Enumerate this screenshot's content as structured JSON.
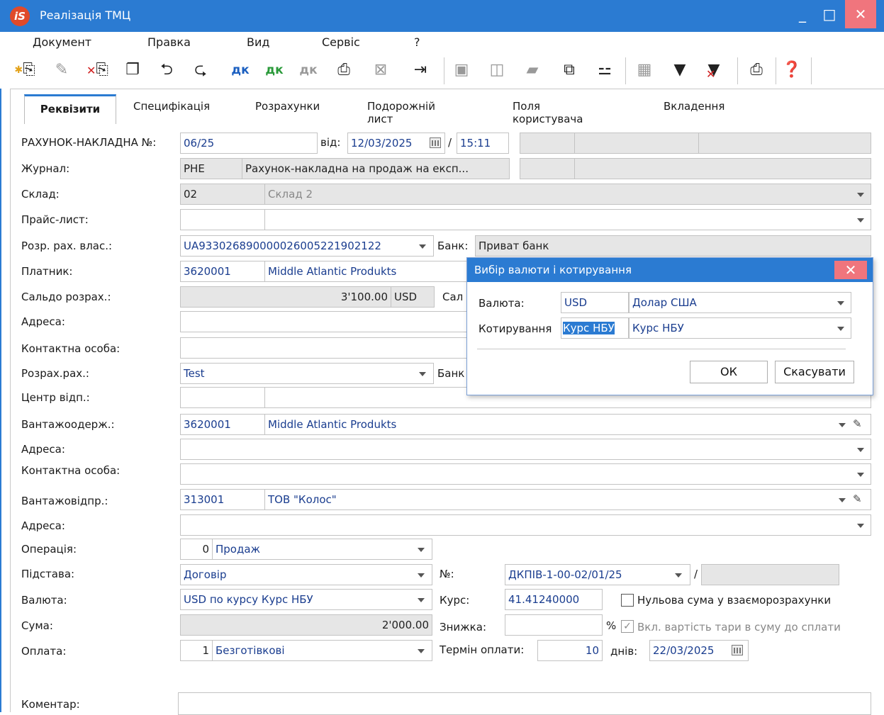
{
  "window": {
    "logo": "iS",
    "title": "Реалізація ТМЦ",
    "minimize": "_",
    "maximize": "□",
    "close": "✕"
  },
  "menu": [
    "Документ",
    "Правка",
    "Вид",
    "Сервіс",
    "?"
  ],
  "toolbar_icons": [
    "add-doc-icon",
    "edit-doc-icon",
    "delete-doc-icon",
    "copy-doc-icon",
    "return-doc-icon",
    "forward-doc-icon",
    "dk-icon",
    "dk-up-icon",
    "dk-down-icon",
    "print-preview-icon",
    "cancel-icon",
    "export-icon",
    "save-icon",
    "book-icon",
    "folder-icon",
    "link-icon",
    "hierarchy-icon",
    "grid-icon",
    "filter-icon",
    "clear-filter-icon",
    "print-icon",
    "help-icon"
  ],
  "tabs": [
    "Реквізити",
    "Специфікація",
    "Розрахунки",
    "Подорожній лист",
    "Поля користувача",
    "Вкладення"
  ],
  "form": {
    "invoice_label": "РАХУНОК-НАКЛАДНА №:",
    "invoice_no": "06/25",
    "from_label": "від:",
    "date": "12/03/2025",
    "time_sep": "/",
    "time": "15:11",
    "journal_label": "Журнал:",
    "journal_code": "РНЕ",
    "journal_name": "Рахунок-накладна на продаж на експ...",
    "warehouse_label": "Склад:",
    "warehouse_code": "02",
    "warehouse_name": "Склад 2",
    "pricelist_label": "Прайс-лист:",
    "account_label": "Розр. рах. влас.:",
    "account_value": "UA933026890000026005221902122",
    "bank_label": "Банк:",
    "bank_value": "Приват банк",
    "payer_label": "Платник:",
    "payer_code": "3620001",
    "payer_name": "Middle Atlantic Produkts",
    "balance_label": "Сальдо розрах.:",
    "balance_value": "3'100.00",
    "balance_currency": "USD",
    "balance_trailing": "Сал",
    "address_label": "Адреса:",
    "contact_label": "Контактна особа:",
    "settle_label": "Розрах.рах.:",
    "settle_value": "Test",
    "settle_bank_label": "Банк",
    "center_label": "Центр відп.:",
    "consignee_label": "Вантажоодерж.:",
    "consignee_code": "3620001",
    "consignee_name": "Middle Atlantic Produkts",
    "address2_label": "Адреса:",
    "contact2_label": "Контактна особа:",
    "shipper_label": "Вантажовідпр.:",
    "shipper_code": "313001",
    "shipper_name": "ТОВ \"Колос\"",
    "address3_label": "Адреса:",
    "operation_label": "Операція:",
    "operation_code": "0",
    "operation_name": "Продаж",
    "basis_label": "Підстава:",
    "basis_value": "Договір",
    "number_label": "№:",
    "number_value": "ДКПІВ-1-00-02/01/25",
    "number_sep": "/",
    "currency_label": "Валюта:",
    "currency_value": "USD по курсу Курс НБУ",
    "rate_label": "Курс:",
    "rate_value": "41.41240000",
    "zero_sum_label": "Нульова сума у взаєморозрахунки",
    "sum_label": "Сума:",
    "sum_value": "2'000.00",
    "discount_label": "Знижка:",
    "percent": "%",
    "tare_label": "Вкл. вартість тари в суму до сплати",
    "payment_label": "Оплата:",
    "payment_code": "1",
    "payment_name": "Безготівкові",
    "term_label": "Термін оплати:",
    "term_value": "10",
    "days_label": "днів:",
    "due_date": "22/03/2025",
    "comment_label": "Коментар:"
  },
  "dialog": {
    "title": "Вибір валюти і котирування",
    "currency_label": "Валюта:",
    "currency_code": "USD",
    "currency_name": "Долар США",
    "quote_label": "Котирування",
    "quote_code": "Курс НБУ",
    "quote_name": "Курс НБУ",
    "ok": "ОК",
    "cancel": "Скасувати"
  },
  "colors": {
    "titlebar": "#2b7bd2",
    "close_button": "#f0757d",
    "field_text": "#1a3d8f",
    "readonly_bg": "#e6e6e6"
  }
}
